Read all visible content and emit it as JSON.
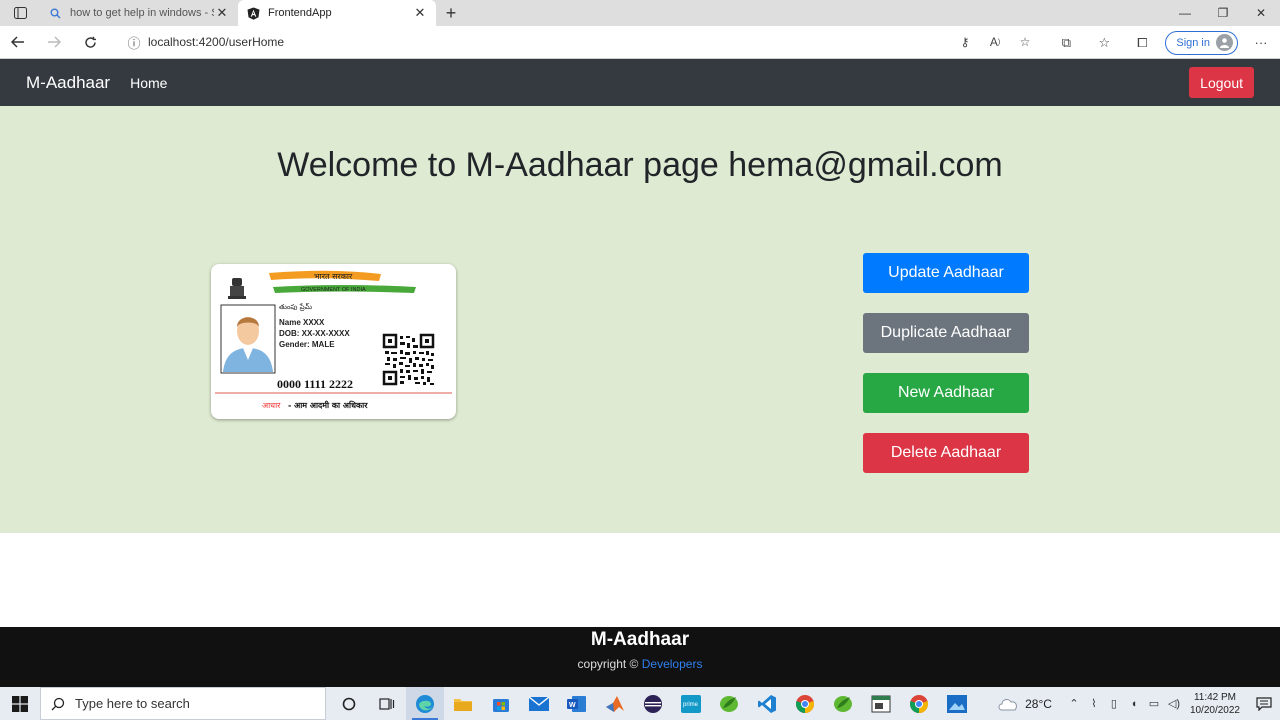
{
  "browser": {
    "tabs": [
      {
        "title": "how to get help in windows - Se",
        "active": false
      },
      {
        "title": "FrontendApp",
        "active": true
      }
    ],
    "url": "localhost:4200/userHome",
    "signin_label": "Sign in"
  },
  "navbar": {
    "brand": "M-Aadhaar",
    "home_label": "Home",
    "logout_label": "Logout"
  },
  "main": {
    "welcome": "Welcome to M-Aadhaar page hema@gmail.com",
    "card": {
      "hindi_header": "भारत सरकार",
      "gov_label": "GOVERNMENT OF INDIA",
      "telugu_name": "తుంపు ప్రేమ్",
      "name_line": "Name XXXX",
      "dob_line": "DOB: XX-XX-XXXX",
      "gender_line": "Gender: MALE",
      "number": "0000 1111 2222",
      "tagline_red": "आधार",
      "tagline_rest": "- आम आदमी का अधिकार"
    },
    "buttons": {
      "update": "Update Aadhaar",
      "duplicate": "Duplicate Aadhaar",
      "new": "New Aadhaar",
      "delete": "Delete Aadhaar"
    },
    "background_color": "#deead1"
  },
  "footer": {
    "title": "M-Aadhaar",
    "copyright": "copyright ©",
    "link": "Developers"
  },
  "taskbar": {
    "search_placeholder": "Type here to search",
    "weather": "28°C",
    "time": "11:42 PM",
    "date": "10/20/2022"
  }
}
